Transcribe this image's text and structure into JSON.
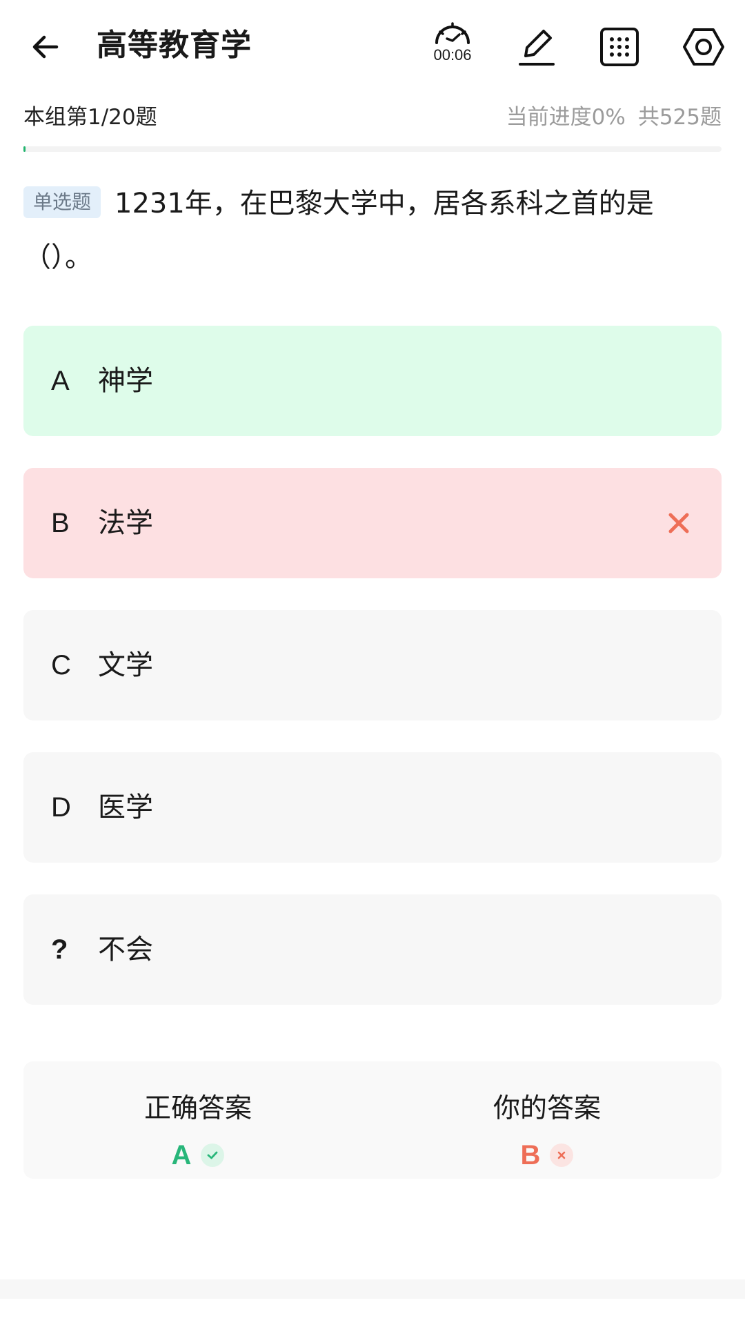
{
  "header": {
    "title": "高等教育学",
    "timer": "00:06",
    "icons": [
      "back-arrow-icon",
      "stopwatch-icon",
      "edit-pencil-icon",
      "answer-card-grid-icon",
      "settings-gear-icon"
    ]
  },
  "progress": {
    "group_text": "本组第1/20题",
    "overall_text": "当前进度0%",
    "total_text": "共525题",
    "percent": 0
  },
  "question": {
    "type_label": "单选题",
    "text": "1231年，在巴黎大学中，居各系科之首的是（）。"
  },
  "options": [
    {
      "key": "A",
      "text": "神学",
      "state": "correct"
    },
    {
      "key": "B",
      "text": "法学",
      "state": "wrong"
    },
    {
      "key": "C",
      "text": "文学",
      "state": "normal"
    },
    {
      "key": "D",
      "text": "医学",
      "state": "normal"
    },
    {
      "key": "?",
      "text": "不会",
      "state": "normal"
    }
  ],
  "answers": {
    "correct_label": "正确答案",
    "correct_value": "A",
    "yours_label": "你的答案",
    "yours_value": "B"
  },
  "colors": {
    "correct_bg": "#defcea",
    "wrong_bg": "#fde0e2",
    "neutral_bg": "#f7f7f7",
    "correct_accent": "#28b67a",
    "wrong_accent": "#ee6e57",
    "badge_bg": "#e3effa"
  }
}
